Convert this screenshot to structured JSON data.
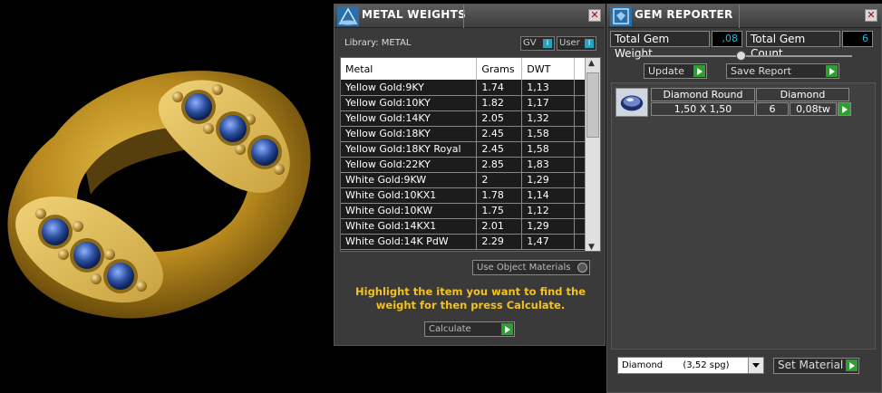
{
  "metal_weights": {
    "title": "METAL WEIGHTS",
    "library_label": "Library: METAL",
    "gv_label": "GV",
    "user_label": "User",
    "toggle_mark": "I",
    "columns": [
      "Metal",
      "Grams",
      "DWT"
    ],
    "rows": [
      [
        "Yellow Gold:9KY",
        "1.74",
        "1,13"
      ],
      [
        "Yellow Gold:10KY",
        "1.82",
        "1,17"
      ],
      [
        "Yellow Gold:14KY",
        "2.05",
        "1,32"
      ],
      [
        "Yellow Gold:18KY",
        "2.45",
        "1,58"
      ],
      [
        "Yellow Gold:18KY Royal",
        "2.45",
        "1,58"
      ],
      [
        "Yellow Gold:22KY",
        "2.85",
        "1,83"
      ],
      [
        "White Gold:9KW",
        "2",
        "1,29"
      ],
      [
        "White Gold:10KX1",
        "1.78",
        "1,14"
      ],
      [
        "White Gold:10KW",
        "1.75",
        "1,12"
      ],
      [
        "White Gold:14KX1",
        "2.01",
        "1,29"
      ],
      [
        "White Gold:14K PdW",
        "2.29",
        "1,47"
      ]
    ],
    "use_object_materials_label": "Use Object Materials",
    "hint": "Highlight the item you want to find the weight for then press Calculate.",
    "calculate_label": "Calculate"
  },
  "gem_reporter": {
    "title": "GEM REPORTER",
    "total_weight_label": "Total Gem Weight",
    "total_weight_value": ",08",
    "total_count_label": "Total Gem Count",
    "total_count_value": "6",
    "update_label": "Update",
    "save_report_label": "Save Report",
    "gem": {
      "name": "Diamond Round",
      "type": "Diamond",
      "size": "1,50 X 1,50",
      "count": "6",
      "weight": "0,08tw"
    },
    "material_select": "Diamond       (3,52 spg)",
    "set_material_label": "Set Material"
  },
  "colors": {
    "hint_yellow": "#f3c21c",
    "value_blue": "#2bb5e0",
    "go_green": "#2e9e2e",
    "ring_gold": "#c9a032",
    "sapphire_blue": "#2b4f9e"
  }
}
